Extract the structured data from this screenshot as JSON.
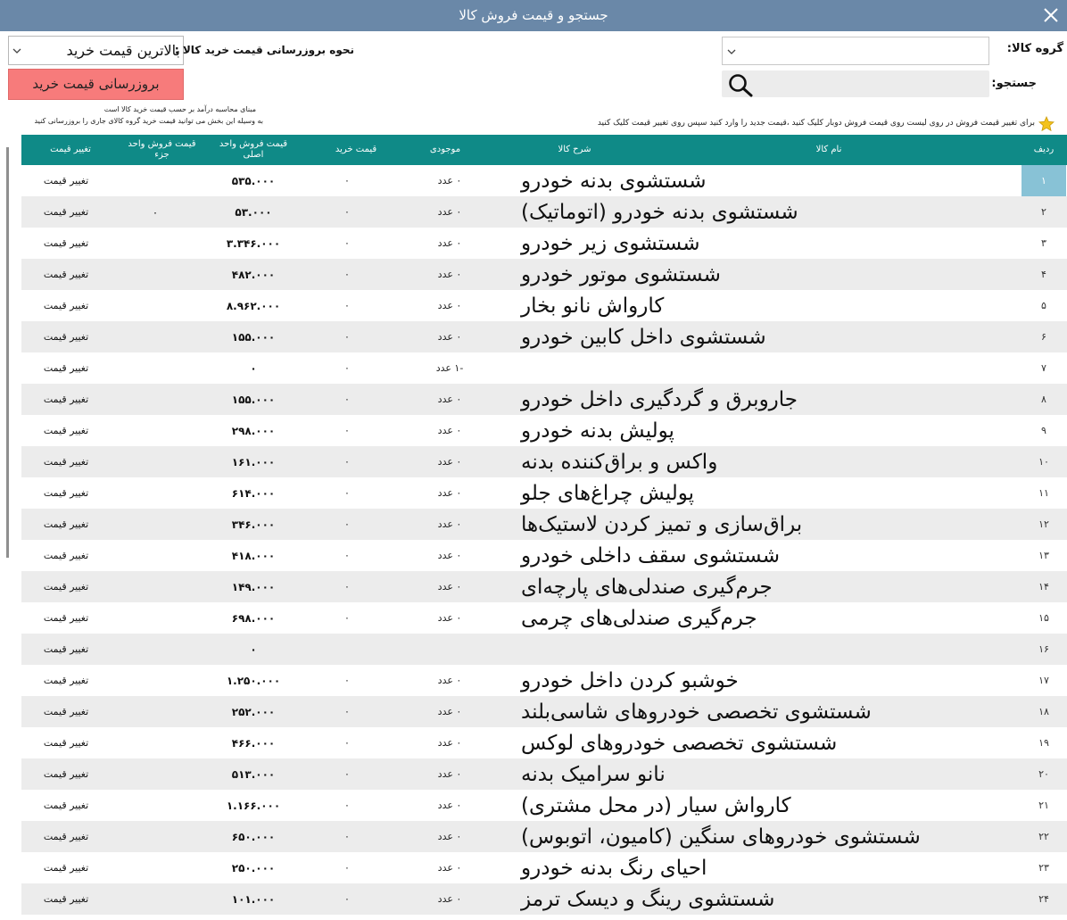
{
  "window": {
    "title": "جستجو و قیمت فروش کالا"
  },
  "controls": {
    "update_method_label": "نحوه بروزرسانی قیمت خرید کالا :",
    "update_method_value": "بالاترین قیمت خرید",
    "update_button": "بروزرسانی قیمت خرید",
    "note_line1": "مبنای محاسبه درآمد بر حسب قیمت خرید کالا است",
    "note_line2": "به وسیله این بخش می توانید قیمت خرید گروه کالای جاری را بروزرسانی کنید",
    "group_label": "گروه کالا:",
    "group_value": "",
    "search_label": "جستجو:",
    "search_value": "",
    "hint": "برای تغییر قیمت فروش در روی لیست روی قیمت فروش دوبار کلیک کنید ،قیمت جدید را وارد کنید سپس روی تغییر قیمت کلیک کنید"
  },
  "table": {
    "headers": {
      "index": "ردیف",
      "name": "نام کالا",
      "desc": "شرح کالا",
      "stock": "موجودی",
      "buy": "قیمت خرید",
      "sell": "قیمت فروش واحد اصلی",
      "part": "قیمت فروش واحد جزء",
      "change": "تغییر قیمت"
    },
    "rows": [
      {
        "idx": "۱",
        "name": "شستشوی بدنه خودرو",
        "stock": "۰ عدد",
        "buy": "۰",
        "sell": "۵۳۵.۰۰۰",
        "part": "",
        "change": "تغییر قیمت"
      },
      {
        "idx": "۲",
        "name": "شستشوی بدنه خودرو (اتوماتیک)",
        "stock": "۰ عدد",
        "buy": "۰",
        "sell": "۵۳.۰۰۰",
        "part": "۰",
        "change": "تغییر قیمت"
      },
      {
        "idx": "۳",
        "name": "شستشوی زیر خودرو",
        "stock": "۰ عدد",
        "buy": "۰",
        "sell": "۳.۳۴۶.۰۰۰",
        "part": "",
        "change": "تغییر قیمت"
      },
      {
        "idx": "۴",
        "name": "شستشوی موتور خودرو",
        "stock": "۰ عدد",
        "buy": "۰",
        "sell": "۴۸۲.۰۰۰",
        "part": "",
        "change": "تغییر قیمت"
      },
      {
        "idx": "۵",
        "name": "کارواش نانو بخار",
        "stock": "۰ عدد",
        "buy": "۰",
        "sell": "۸.۹۶۲.۰۰۰",
        "part": "",
        "change": "تغییر قیمت"
      },
      {
        "idx": "۶",
        "name": "شستشوی داخل کابین خودرو",
        "stock": "۰ عدد",
        "buy": "۰",
        "sell": "۱۵۵.۰۰۰",
        "part": "",
        "change": "تغییر قیمت"
      },
      {
        "idx": "۷",
        "name": "",
        "stock": "-۱ عدد",
        "buy": "۰",
        "sell": "۰",
        "part": "",
        "change": "تغییر قیمت"
      },
      {
        "idx": "۸",
        "name": "جاروبرق و گردگیری داخل خودرو",
        "stock": "۰ عدد",
        "buy": "۰",
        "sell": "۱۵۵.۰۰۰",
        "part": "",
        "change": "تغییر قیمت"
      },
      {
        "idx": "۹",
        "name": "پولیش بدنه خودرو",
        "stock": "۰ عدد",
        "buy": "۰",
        "sell": "۲۹۸.۰۰۰",
        "part": "",
        "change": "تغییر قیمت"
      },
      {
        "idx": "۱۰",
        "name": "واکس و براق‌کننده بدنه",
        "stock": "۰ عدد",
        "buy": "۰",
        "sell": "۱۶۱.۰۰۰",
        "part": "",
        "change": "تغییر قیمت"
      },
      {
        "idx": "۱۱",
        "name": "پولیش چراغ‌های جلو",
        "stock": "۰ عدد",
        "buy": "۰",
        "sell": "۶۱۴.۰۰۰",
        "part": "",
        "change": "تغییر قیمت"
      },
      {
        "idx": "۱۲",
        "name": "براق‌سازی و تمیز کردن لاستیک‌ها",
        "stock": "۰ عدد",
        "buy": "۰",
        "sell": "۳۴۶.۰۰۰",
        "part": "",
        "change": "تغییر قیمت"
      },
      {
        "idx": "۱۳",
        "name": "شستشوی سقف داخلی خودرو",
        "stock": "۰ عدد",
        "buy": "۰",
        "sell": "۴۱۸.۰۰۰",
        "part": "",
        "change": "تغییر قیمت"
      },
      {
        "idx": "۱۴",
        "name": "جرم‌گیری صندلی‌های پارچه‌ای",
        "stock": "۰ عدد",
        "buy": "۰",
        "sell": "۱۴۹.۰۰۰",
        "part": "",
        "change": "تغییر قیمت"
      },
      {
        "idx": "۱۵",
        "name": "جرم‌گیری صندلی‌های چرمی",
        "stock": "۰ عدد",
        "buy": "۰",
        "sell": "۶۹۸.۰۰۰",
        "part": "",
        "change": "تغییر قیمت"
      },
      {
        "idx": "۱۶",
        "name": "",
        "stock": "",
        "buy": "",
        "sell": "۰",
        "part": "",
        "change": "تغییر قیمت"
      },
      {
        "idx": "۱۷",
        "name": "خوشبو کردن داخل خودرو",
        "stock": "۰ عدد",
        "buy": "۰",
        "sell": "۱.۲۵۰.۰۰۰",
        "part": "",
        "change": "تغییر قیمت"
      },
      {
        "idx": "۱۸",
        "name": "شستشوی تخصصی خودروهای شاسی‌بلند",
        "stock": "۰ عدد",
        "buy": "۰",
        "sell": "۲۵۲.۰۰۰",
        "part": "",
        "change": "تغییر قیمت"
      },
      {
        "idx": "۱۹",
        "name": "شستشوی تخصصی خودروهای لوکس",
        "stock": "۰ عدد",
        "buy": "۰",
        "sell": "۴۶۶.۰۰۰",
        "part": "",
        "change": "تغییر قیمت"
      },
      {
        "idx": "۲۰",
        "name": "نانو سرامیک بدنه",
        "stock": "۰ عدد",
        "buy": "۰",
        "sell": "۵۱۳.۰۰۰",
        "part": "",
        "change": "تغییر قیمت"
      },
      {
        "idx": "۲۱",
        "name": "کارواش سیار (در محل مشتری)",
        "stock": "۰ عدد",
        "buy": "۰",
        "sell": "۱.۱۶۶.۰۰۰",
        "part": "",
        "change": "تغییر قیمت"
      },
      {
        "idx": "۲۲",
        "name": "شستشوی خودروهای سنگین (کامیون، اتوبوس)",
        "stock": "۰ عدد",
        "buy": "۰",
        "sell": "۶۵۰.۰۰۰",
        "part": "",
        "change": "تغییر قیمت"
      },
      {
        "idx": "۲۳",
        "name": "احیای رنگ بدنه خودرو",
        "stock": "۰ عدد",
        "buy": "۰",
        "sell": "۲۵۰.۰۰۰",
        "part": "",
        "change": "تغییر قیمت"
      },
      {
        "idx": "۲۴",
        "name": "شستشوی رینگ و دیسک ترمز",
        "stock": "۰ عدد",
        "buy": "۰",
        "sell": "۱۰۱.۰۰۰",
        "part": "",
        "change": "تغییر قیمت"
      }
    ],
    "selected_row": 0
  }
}
